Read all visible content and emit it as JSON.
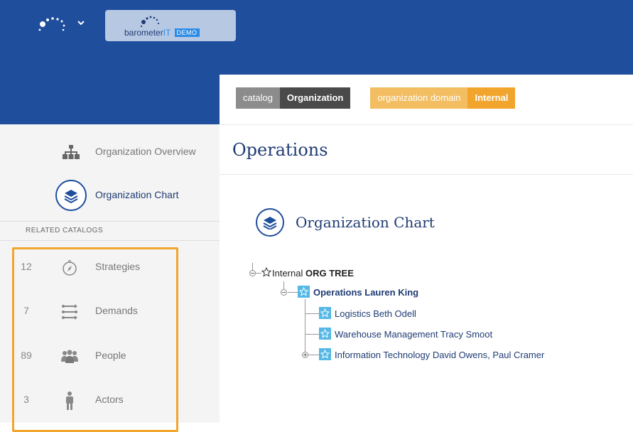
{
  "header": {
    "brand_main": "barometer",
    "brand_it": "IT",
    "brand_demo": "DEMO"
  },
  "sidebar": {
    "nav": [
      {
        "label": "Organization Overview",
        "icon": "org-tree-icon"
      },
      {
        "label": "Organization Chart",
        "icon": "layers-icon",
        "active": true
      }
    ],
    "related_header": "RELATED CATALOGS",
    "catalogs": [
      {
        "count": "12",
        "label": "Strategies",
        "icon": "compass-icon"
      },
      {
        "count": "7",
        "label": "Demands",
        "icon": "demands-icon"
      },
      {
        "count": "89",
        "label": "People",
        "icon": "people-icon"
      },
      {
        "count": "3",
        "label": "Actors",
        "icon": "actor-icon"
      }
    ]
  },
  "breadcrumbs": {
    "catalog_key": "catalog",
    "catalog_value": "Organization",
    "domain_key": "organization domain",
    "domain_value": "Internal"
  },
  "page": {
    "title": "Operations",
    "section_title": "Organization Chart"
  },
  "tree": {
    "root_prefix": "Internal",
    "root_bold": "ORG TREE",
    "nodes": [
      {
        "name": "Operations",
        "people": "Lauren King"
      },
      {
        "name": "Logistics",
        "people": "Beth Odell"
      },
      {
        "name": "Warehouse Management",
        "people": "Tracy Smoot"
      },
      {
        "name": "Information Technology",
        "people": "David Owens, Paul Cramer"
      }
    ]
  },
  "colors": {
    "header_blue": "#1f4e9d",
    "accent_orange": "#f2a52d",
    "star_blue": "#55b8e6",
    "title_navy": "#1f3b74"
  }
}
